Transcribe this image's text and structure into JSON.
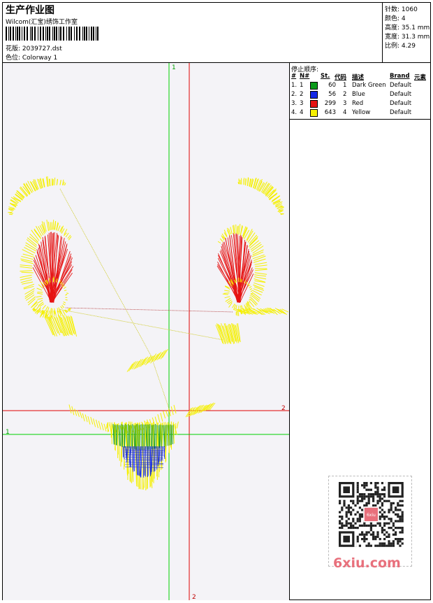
{
  "header": {
    "title": "生产作业图",
    "company": "Wilcom(汇宝)绣饰工作室",
    "design_label": "花版: 2039727.dst",
    "colorway_label": "色位:  Colorway 1"
  },
  "specs": {
    "stitches": "针数: 1060",
    "colors": "颜色: 4",
    "height": "高度: 35.1 mm",
    "width": "宽度: 31.3 mm",
    "ratio": "比例: 4.29"
  },
  "stop_sequence": {
    "title": "停止顺序:",
    "headers": [
      "#",
      "N#",
      "St.",
      "代码",
      "描述",
      "Brand",
      "元素"
    ],
    "rows": [
      {
        "idx": "1.",
        "n": "1",
        "color": "#0a9a1a",
        "st": "60",
        "code": "1",
        "desc": "Dark Green",
        "brand": "Default"
      },
      {
        "idx": "2.",
        "n": "2",
        "color": "#1428e6",
        "st": "56",
        "code": "2",
        "desc": "Blue",
        "brand": "Default"
      },
      {
        "idx": "3.",
        "n": "3",
        "color": "#e61414",
        "st": "299",
        "code": "3",
        "desc": "Red",
        "brand": "Default"
      },
      {
        "idx": "4.",
        "n": "4",
        "color": "#f5f000",
        "st": "643",
        "code": "4",
        "desc": "Yellow",
        "brand": "Default"
      }
    ]
  },
  "guides": {
    "green_label": "1",
    "red_label": "2",
    "green_color": "#00d000",
    "red_color": "#e00000"
  },
  "thread_colors": {
    "yellow": "#f5f000",
    "red": "#e61414",
    "green": "#0a9a1a",
    "blue": "#1428e6"
  },
  "watermark": "6xiu.com",
  "qr_badge": "6xiu"
}
